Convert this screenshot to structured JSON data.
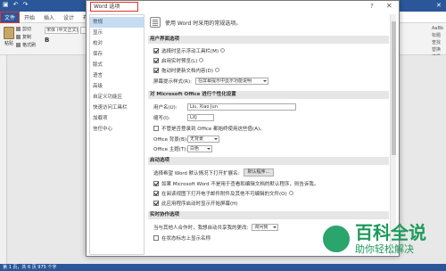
{
  "word": {
    "file_tab": "文件",
    "tabs": [
      "开始",
      "插入",
      "设计",
      "布"
    ],
    "paste_label": "粘贴",
    "clipboard": [
      "剪切",
      "复制",
      "格式刷"
    ],
    "font_name": "宋体 (中文正文)",
    "bold": "B",
    "help": "?",
    "close": "✕",
    "right_ribbon": [
      "AaBb",
      "标题",
      "查找",
      "替换",
      "选择"
    ],
    "status": "第 1 页，共 6 页    975 个字"
  },
  "dialog": {
    "title": "Word 选项",
    "help": "?",
    "close": "✕",
    "nav": [
      "常规",
      "显示",
      "校对",
      "保存",
      "版式",
      "语言",
      "高级",
      "自定义功能区",
      "快速访问工具栏",
      "加载项",
      "信任中心"
    ],
    "header": "使用 Word 时采用的常规选项。",
    "sections": {
      "ui": "用户界面选项",
      "personalize": "对 Microsoft Office 进行个性化设置",
      "startup": "启动选项",
      "realtime": "实时协作选项"
    },
    "ui_options": [
      {
        "label": "选择时显示浮动工具栏(M)",
        "checked": true
      },
      {
        "label": "启用实时预览(L)",
        "checked": true
      },
      {
        "label": "拖动时更新文档内容(D)",
        "checked": true
      }
    ],
    "screentip_label": "屏幕提示样式(R):",
    "screentip_value": "在屏幕提示中显示功能说明",
    "username_label": "用户名(U):",
    "username_value": "Liu, Xiao Jun",
    "initials_label": "缩写(I):",
    "initials_value": "LXJ",
    "always_use": {
      "label": "不管是否登录到 Office 都始终使用这些值(A)。",
      "checked": false
    },
    "bg_label": "Office 背景(B):",
    "bg_value": "无背景",
    "theme_label": "Office 主题(T):",
    "theme_value": "白色",
    "ext_label": "选择希望 Word 默认情况下打开扩展名:",
    "ext_button": "默认程序...",
    "startup_options": [
      {
        "label": "如果 Microsoft Word 不是用于查看和编辑文档的默认程序，则告诉我。",
        "checked": true
      },
      {
        "label": "在阅读视图下打开电子邮件附件及其他不可编辑的文件(O)",
        "checked": true
      },
      {
        "label": "此应用程序启动时显示开始屏幕(H)",
        "checked": true
      }
    ],
    "share_label": "当与其他人合作时，我想自动共享我的更改:",
    "share_value": "询问我",
    "presence": {
      "label": "在状态标志上显示名称",
      "checked": false
    }
  },
  "watermark": {
    "big": "百科全说",
    "small": "助你轻松解决"
  }
}
